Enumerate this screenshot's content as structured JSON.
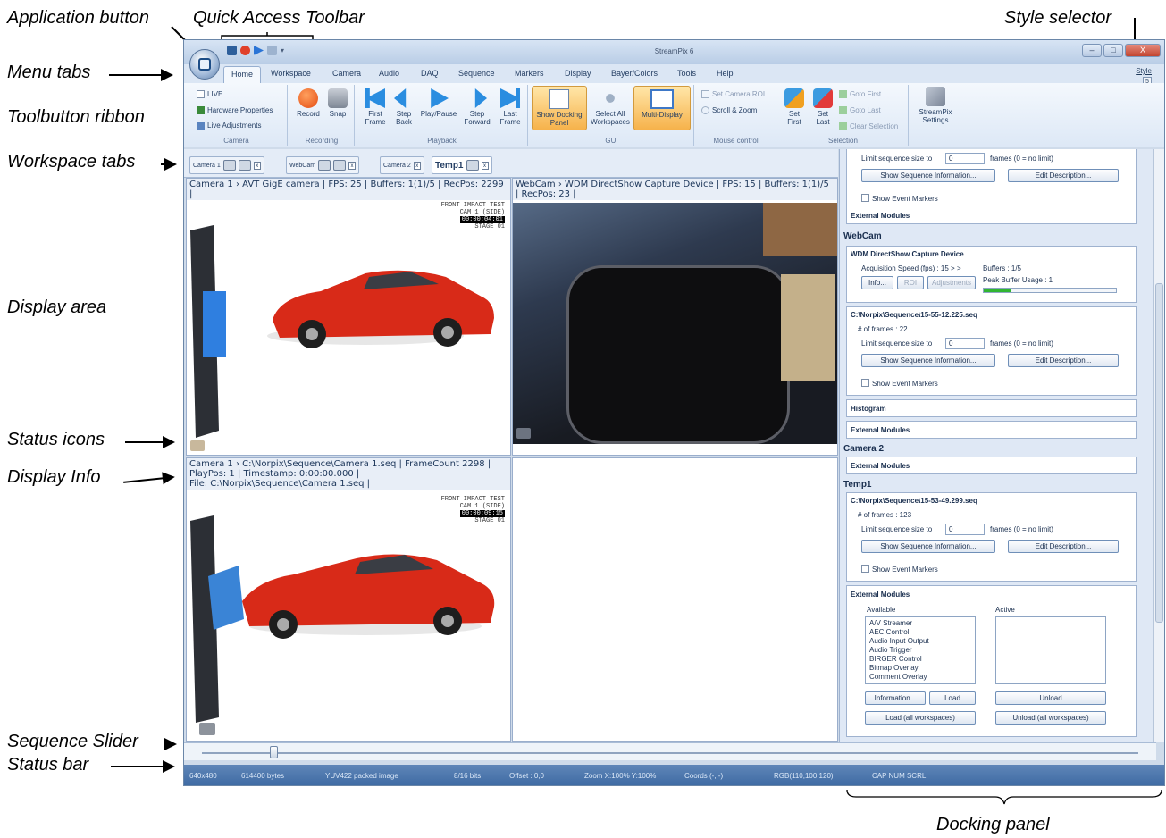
{
  "annotations": {
    "application_button": "Application button",
    "quick_access_toolbar": "Quick Access Toolbar",
    "style_selector": "Style selector",
    "menu_tabs": "Menu tabs",
    "toolbutton_ribbon": "Toolbutton ribbon",
    "workspace_tabs": "Workspace tabs",
    "display_area": "Display area",
    "status_icons": "Status icons",
    "display_info": "Display Info",
    "sequence_slider": "Sequence Slider",
    "status_bar": "Status bar",
    "docking_panel": "Docking panel"
  },
  "window": {
    "title": "StreamPix 6",
    "min": "–",
    "max": "□",
    "close": "X",
    "style_label": "Style",
    "style_value": "5"
  },
  "menu_tabs": [
    "Home",
    "Workspace",
    "Camera",
    "Audio",
    "DAQ",
    "Sequence",
    "Markers",
    "Display",
    "Bayer/Colors",
    "Tools",
    "Help"
  ],
  "ribbon": {
    "camera_group": {
      "live": "LIVE",
      "hardware": "Hardware Properties",
      "live_adj": "Live Adjustments",
      "label": "Camera"
    },
    "recording_group": {
      "record": "Record",
      "snap": "Snap",
      "label": "Recording"
    },
    "playback_group": {
      "first_frame": "First Frame",
      "step_back": "Step Back",
      "play_pause": "Play/Pause",
      "step_forward": "Step Forward",
      "last_frame": "Last Frame",
      "label": "Playback"
    },
    "gui_group": {
      "show_docking": "Show Docking Panel",
      "select_all": "Select All Workspaces",
      "multi_display": "Multi-Display",
      "label": "GUI"
    },
    "mouse_group": {
      "set_roi": "Set Camera ROI",
      "scroll_zoom": "Scroll & Zoom",
      "label": "Mouse control"
    },
    "selection_group": {
      "set_first": "Set First",
      "set_last": "Set Last",
      "goto_first": "Goto First",
      "goto_last": "Goto Last",
      "clear_sel": "Clear Selection",
      "label": "Selection"
    },
    "settings": "StreamPix Settings"
  },
  "workspace_tabs": [
    "Camera 1",
    "WebCam",
    "Camera 2",
    "Temp1"
  ],
  "panes": {
    "cam1_info": "Camera 1 › AVT GigE camera | FPS: 25 | Buffers: 1(1)/5 | RecPos: 2299 |",
    "webcam_info": "WebCam › WDM DirectShow Capture Device | FPS: 15 | Buffers: 1(1)/5 | RecPos: 23 |",
    "seq_info_1": "Camera 1 › C:\\Norpix\\Sequence\\Camera 1.seq | FrameCount 2298 |",
    "seq_info_2": "PlayPos: 1 | Timestamp: 0:00:00.000 |",
    "seq_info_3": "File: C:\\Norpix\\Sequence\\Camera 1.seq |",
    "overlay_title": "FRONT IMPACT TEST",
    "overlay_cam": "CAM 1 (SIDE)",
    "overlay_stage": "STAGE 01",
    "tc_live": "00:00:04:01",
    "tc_seq": "00:00:09:15"
  },
  "dock": {
    "limit_label": "Limit sequence size to",
    "limit_value": "0",
    "frames_label": "frames (0 = no limit)",
    "show_seq_info": "Show Sequence Information...",
    "edit_desc": "Edit Description...",
    "show_markers": "Show Event Markers",
    "external_modules": "External Modules",
    "histogram": "Histogram",
    "webcam_title": "WebCam",
    "device": "WDM DirectShow Capture Device",
    "acq_speed": "Acquisition Speed (fps) : 15 > >",
    "buffers": "Buffers : 1/5",
    "peak": "Peak Buffer Usage : 1",
    "info_btn": "Info...",
    "roi_btn": "ROI",
    "adj_btn": "Adjustments",
    "seq_path_1": "C:\\Norpix\\Sequence\\15-55-12.225.seq",
    "frames_1": "# of frames : 22",
    "camera2_title": "Camera 2",
    "temp1_title": "Temp1",
    "seq_path_2": "C:\\Norpix\\Sequence\\15-53-49.299.seq",
    "frames_2": "# of frames : 123",
    "available": "Available",
    "active": "Active",
    "modules": [
      "A/V Streamer",
      "AEC Control",
      "Audio Input Output",
      "Audio Trigger",
      "BIRGER Control",
      "Bitmap Overlay",
      "Comment Overlay"
    ],
    "information_btn": "Information...",
    "load_btn": "Load",
    "unload_btn": "Unload",
    "load_all_btn": "Load (all workspaces)",
    "unload_all_btn": "Unload (all workspaces)"
  },
  "statusbar": [
    "640x480",
    "614400 bytes",
    "YUV422 packed image",
    "8/16 bits",
    "Offset : 0,0",
    "Zoom X:100% Y:100%",
    "Coords (-, -)",
    "RGB(110,100,120)",
    "CAP NUM SCRL"
  ]
}
